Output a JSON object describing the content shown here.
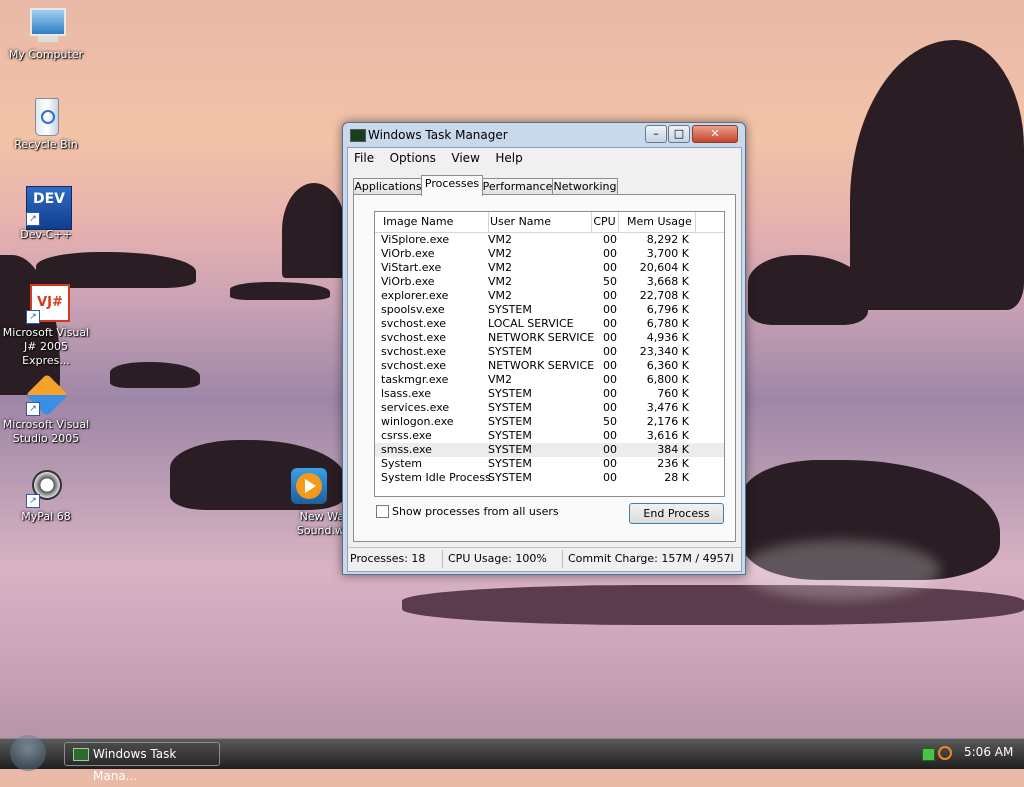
{
  "desktop": {
    "icons": [
      {
        "label_line1": "My Computer",
        "label_line2": "",
        "icon": "computer-icon"
      },
      {
        "label_line1": "Recycle Bin",
        "label_line2": "",
        "icon": "recycle-bin-icon"
      },
      {
        "label_line1": "Dev-C++",
        "label_line2": "",
        "icon": "dev-cpp-icon",
        "badge": "DEV"
      },
      {
        "label_line1": "Microsoft Visual",
        "label_line2": "J# 2005 Expres...",
        "icon": "visual-jsharp-icon",
        "badge": "VJ#"
      },
      {
        "label_line1": "Microsoft Visual",
        "label_line2": "Studio 2005",
        "icon": "visual-studio-icon"
      },
      {
        "label_line1": "MyPal 68",
        "label_line2": "",
        "icon": "mypal-icon"
      },
      {
        "label_line1": "New Wa",
        "label_line2": "Sound.w",
        "icon": "media-player-icon"
      }
    ]
  },
  "window": {
    "title": "Windows Task Manager",
    "controls": {
      "minimize": "–",
      "maximize": "□",
      "close": "✕"
    },
    "menu": [
      "File",
      "Options",
      "View",
      "Help"
    ],
    "tabs": [
      "Applications",
      "Processes",
      "Performance",
      "Networking"
    ],
    "active_tab": "Processes",
    "columns": [
      "Image Name",
      "User Name",
      "CPU",
      "Mem Usage"
    ],
    "processes": [
      [
        "ViSplore.exe",
        "VM2",
        "00",
        "8,292 K"
      ],
      [
        "ViOrb.exe",
        "VM2",
        "00",
        "3,700 K"
      ],
      [
        "ViStart.exe",
        "VM2",
        "00",
        "20,604 K"
      ],
      [
        "ViOrb.exe",
        "VM2",
        "50",
        "3,668 K"
      ],
      [
        "explorer.exe",
        "VM2",
        "00",
        "22,708 K"
      ],
      [
        "spoolsv.exe",
        "SYSTEM",
        "00",
        "6,796 K"
      ],
      [
        "svchost.exe",
        "LOCAL SERVICE",
        "00",
        "6,780 K"
      ],
      [
        "svchost.exe",
        "NETWORK SERVICE",
        "00",
        "4,936 K"
      ],
      [
        "svchost.exe",
        "SYSTEM",
        "00",
        "23,340 K"
      ],
      [
        "svchost.exe",
        "NETWORK SERVICE",
        "00",
        "6,360 K"
      ],
      [
        "taskmgr.exe",
        "VM2",
        "00",
        "6,800 K"
      ],
      [
        "lsass.exe",
        "SYSTEM",
        "00",
        "760 K"
      ],
      [
        "services.exe",
        "SYSTEM",
        "00",
        "3,476 K"
      ],
      [
        "winlogon.exe",
        "SYSTEM",
        "50",
        "2,176 K"
      ],
      [
        "csrss.exe",
        "SYSTEM",
        "00",
        "3,616 K"
      ],
      [
        "smss.exe",
        "SYSTEM",
        "00",
        "384 K"
      ],
      [
        "System",
        "SYSTEM",
        "00",
        "236 K"
      ],
      [
        "System Idle Process",
        "SYSTEM",
        "00",
        "28 K"
      ]
    ],
    "selected_row_index": 15,
    "show_all_users_label": "Show processes from all users",
    "show_all_users_checked": false,
    "end_process_label": "End Process",
    "status": {
      "processes": "Processes: 18",
      "cpu": "CPU Usage: 100%",
      "commit": "Commit Charge: 157M / 4957I"
    }
  },
  "taskbar": {
    "task_label": "Windows Task Mana...",
    "clock": "5:06 AM"
  }
}
